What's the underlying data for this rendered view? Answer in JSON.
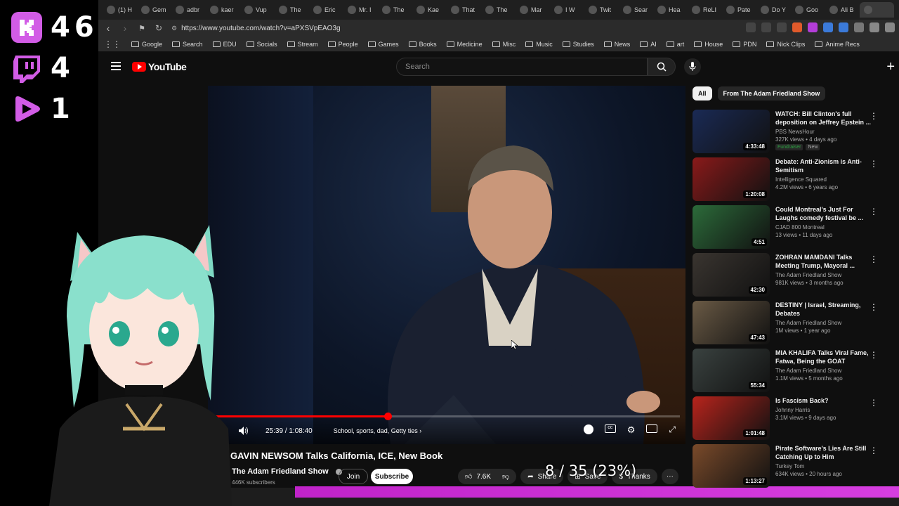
{
  "overlay": {
    "kick_count": "46",
    "twitch_count": "4",
    "rumble_count": "1",
    "colors": {
      "kick": "#d25ce6",
      "twitch": "#9146ff",
      "play": "#d25ce6"
    }
  },
  "browser": {
    "tabs": [
      "(1) H",
      "Gem",
      "adbr",
      "kaer",
      "Vup",
      "The",
      "Eric",
      "Mr. I",
      "The",
      "Kae",
      "That",
      "The",
      "Mar",
      "I W",
      "Twit",
      "Sear",
      "Hea",
      "ReLI",
      "Pate",
      "Do Y",
      "Goo",
      "Ali B",
      ""
    ],
    "url": "https://www.youtube.com/watch?v=aPXSVpEAO3g",
    "bookmarks": [
      "Google",
      "Search",
      "EDU",
      "Socials",
      "Stream",
      "People",
      "Games",
      "Books",
      "Medicine",
      "Misc",
      "Music",
      "Studies",
      "News",
      "AI",
      "art",
      "House",
      "PDN",
      "Nick Clips",
      "Anime Recs"
    ]
  },
  "youtube": {
    "logo_text": "YouTube",
    "search_placeholder": "Search",
    "player": {
      "time": "25:39 / 1:08:40",
      "chapter": "School, sports, dad, Getty ties",
      "progress": 0.3735
    },
    "video": {
      "title": "GAVIN NEWSOM Talks California, ICE, New Book",
      "channel": "The Adam Friedland Show",
      "subscribers": "446K subscribers",
      "join": "Join",
      "subscribe": "Subscribe",
      "likes": "7.6K",
      "share": "Share",
      "save": "Save",
      "thanks": "Thanks"
    },
    "chips": [
      "All",
      "From The Adam Friedland Show"
    ],
    "recommendations": [
      {
        "title": "WATCH: Bill Clinton's full deposition on Jeffrey Epstein ...",
        "channel": "PBS NewsHour",
        "meta": "327K views • 4 days ago",
        "duration": "4:33:48",
        "tags": [
          "Fundraiser",
          "New"
        ],
        "color": "#1a2a55"
      },
      {
        "title": "Debate: Anti-Zionism is Anti-Semitism",
        "channel": "Intelligence Squared",
        "meta": "4.2M views • 6 years ago",
        "duration": "1:20:08",
        "tags": [],
        "color": "#8a1a1a"
      },
      {
        "title": "Could Montreal's Just For Laughs comedy festival be ...",
        "channel": "CJAD 800 Montreal",
        "meta": "13 views • 11 days ago",
        "duration": "4:51",
        "tags": [],
        "color": "#2c6b3a"
      },
      {
        "title": "ZOHRAN MAMDANI Talks Meeting Trump, Mayoral ...",
        "channel": "The Adam Friedland Show",
        "meta": "981K views • 3 months ago",
        "duration": "42:30",
        "tags": [],
        "color": "#3a3530"
      },
      {
        "title": "DESTINY | Israel, Streaming, Debates",
        "channel": "The Adam Friedland Show",
        "meta": "1M views • 1 year ago",
        "duration": "47:43",
        "tags": [],
        "color": "#6a5a45"
      },
      {
        "title": "MIA KHALIFA Talks Viral Fame, Fatwa, Being the GOAT",
        "channel": "The Adam Friedland Show",
        "meta": "1.1M views • 5 months ago",
        "duration": "55:34",
        "tags": [],
        "color": "#3a4240"
      },
      {
        "title": "Is Fascism Back?",
        "channel": "Johnny Harris",
        "meta": "3.1M views • 9 days ago",
        "duration": "1:01:48",
        "tags": [],
        "color": "#b8241c"
      },
      {
        "title": "Pirate Software's Lies Are Still Catching Up to Him",
        "channel": "Turkey Tom",
        "meta": "634K views • 20 hours ago",
        "duration": "1:13:27",
        "tags": [],
        "color": "#7a4a2a"
      }
    ]
  },
  "counter_overlay": "8 / 35 (23%)",
  "colors": {
    "accent": "#ff0000",
    "background": "#0f0f0f",
    "taskbar_bar": "#c023c9"
  }
}
